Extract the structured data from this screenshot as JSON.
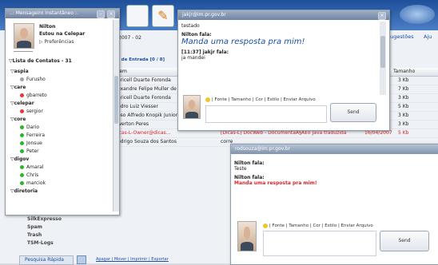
{
  "messenger": {
    "title": "..: Mensageiro Instantâneo :.",
    "user_name": "Nilton",
    "user_status": "Estou na Celepar",
    "preferences": "Preferências",
    "contacts_header": "Lista de Contatos - 31",
    "groups": [
      {
        "name": "aspia",
        "contacts": [
          {
            "name": "Furusho",
            "status": "offline"
          }
        ]
      },
      {
        "name": "care",
        "contacts": [
          {
            "name": "gbarreto",
            "status": "busy"
          }
        ]
      },
      {
        "name": "celepar",
        "contacts": [
          {
            "name": "sergior",
            "status": "busy"
          }
        ]
      },
      {
        "name": "core",
        "contacts": [
          {
            "name": "Dario",
            "status": "online"
          },
          {
            "name": "Ferreira",
            "status": "online"
          },
          {
            "name": "Jonsue",
            "status": "online"
          },
          {
            "name": "Peter",
            "status": "online"
          }
        ]
      },
      {
        "name": "digov",
        "contacts": [
          {
            "name": "Amaral",
            "status": "online"
          },
          {
            "name": "Chris",
            "status": "online"
          },
          {
            "name": "marciok",
            "status": "online"
          }
        ]
      },
      {
        "name": "diretoria",
        "contacts": []
      }
    ]
  },
  "mail": {
    "date_label": "2007 - 02",
    "inbox_label": "a de Entrada [0 / 8]",
    "col_from": "rem",
    "col_size": "Tamanho",
    "suggestions": "Sugestões",
    "help": "Aju",
    "rows": [
      {
        "from": "aricell Duarte Foronda",
        "subject": "",
        "date": "",
        "size": "3 Kb",
        "highlight": false
      },
      {
        "from": "exandre Felipe Muller de",
        "subject": "",
        "date": "7",
        "size": "7 Kb",
        "highlight": false
      },
      {
        "from": "aricell Duarte Foronda",
        "subject": "",
        "date": "7",
        "size": "3 Kb",
        "highlight": false
      },
      {
        "from": "edro Luiz Viesser",
        "subject": "",
        "date": "7",
        "size": "5 Kb",
        "highlight": false
      },
      {
        "from": "oso Alfredo Knopik Junior",
        "subject": "",
        "date": "7",
        "size": "3 Kb",
        "highlight": false
      },
      {
        "from": "werton Peres",
        "subject": "",
        "date": "7",
        "size": "3 Kb",
        "highlight": false
      },
      {
        "from": "icas-L-Owner@dicas...",
        "subject": "[Dicas-L] DocWeb - DocumentaÃ§Ã£o Java traduzida",
        "date": "16/04/2007",
        "size": "5 Kb",
        "highlight": true
      },
      {
        "from": "odrigo Souza dos Santos",
        "subject": "corre",
        "date": "",
        "size": "",
        "highlight": false
      }
    ],
    "folders": [
      "SilkExpresso",
      "Spam",
      "Trash",
      "TSM-Logs"
    ],
    "quick_search": "Pesquisa Rápida",
    "bottom_actions": "Apagar | Mover | Imprimir | Exportar"
  },
  "chat1": {
    "title": "jakjr@im.pr.gov.br",
    "messages": [
      {
        "sender": "",
        "text": "testado",
        "style": "plain"
      },
      {
        "sender": "Nilton fala:",
        "text": "Manda uma resposta pra mim!",
        "style": "big-italic"
      },
      {
        "sender": "[11:37] jakjr fala:",
        "text": "ja mandei",
        "style": "plain"
      }
    ],
    "toolbar": "|  Fonte  |  Tamanho  |  Cor  |  Estilo  |  Enviar Arquivo",
    "send": "Send"
  },
  "chat2": {
    "title": "rodsouza@im.pr.gov.br",
    "messages": [
      {
        "sender": "Nilton fala:",
        "text": "Teste",
        "style": "plain"
      },
      {
        "sender": "Nilton fala:",
        "text": "Manda uma resposta pra mim!",
        "style": "red"
      }
    ],
    "toolbar": "|  Fonte  |  Tamanho  |  Cor  |  Estilo  |  Enviar Arquivo",
    "send": "Send"
  },
  "colors": {
    "online": "#2bb52b",
    "busy": "#e03a3a",
    "offline": "#9aa4b0",
    "title_blue": "#7084a2",
    "link_blue": "#1c4fa8"
  }
}
